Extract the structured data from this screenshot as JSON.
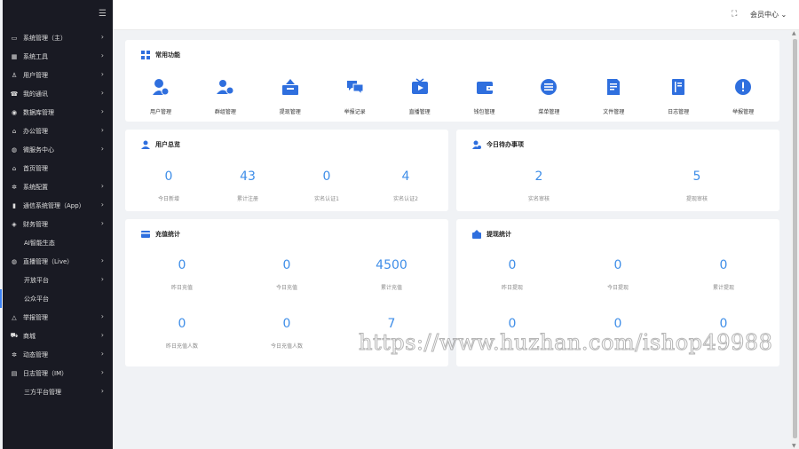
{
  "sidebar": {
    "items": [
      {
        "label": "系统管理（主）",
        "icon": "monitor-icon",
        "arrow": true
      },
      {
        "label": "系统工具",
        "icon": "grid-icon",
        "arrow": true
      },
      {
        "label": "用户管理",
        "icon": "users-icon",
        "arrow": true
      },
      {
        "label": "我的通讯",
        "icon": "phone-icon",
        "arrow": true
      },
      {
        "label": "数据库管理",
        "icon": "database-icon",
        "arrow": true
      },
      {
        "label": "办公管理",
        "icon": "office-icon",
        "arrow": true
      },
      {
        "label": "微服务中心",
        "icon": "globe-icon",
        "arrow": true
      },
      {
        "label": "首页管理",
        "icon": "home-icon",
        "arrow": false
      },
      {
        "label": "系统配置",
        "icon": "settings-icon",
        "arrow": true
      },
      {
        "label": "通信系统管理（App）",
        "icon": "signal-icon",
        "arrow": true
      },
      {
        "label": "财务管理",
        "icon": "finance-icon",
        "arrow": true
      },
      {
        "label": "AI智能生态",
        "icon": "",
        "arrow": false,
        "sub": true
      },
      {
        "label": "直播管理（Live）",
        "icon": "globe-icon",
        "arrow": true
      },
      {
        "label": "开放平台",
        "icon": "",
        "arrow": true,
        "sub": true
      },
      {
        "label": "公众平台",
        "icon": "",
        "arrow": false,
        "sub": true
      },
      {
        "label": "举报管理",
        "icon": "warning-icon",
        "arrow": true
      },
      {
        "label": "商城",
        "icon": "cart-icon",
        "arrow": true
      },
      {
        "label": "动态管理",
        "icon": "settings-icon",
        "arrow": true
      },
      {
        "label": "日志管理（IM）",
        "icon": "log-icon",
        "arrow": true
      },
      {
        "label": "三方平台管理",
        "icon": "",
        "arrow": true,
        "sub": true
      }
    ]
  },
  "header": {
    "member_center": "会员中心 ⌄"
  },
  "quick": {
    "title": "常用功能",
    "items": [
      {
        "label": "用户管理",
        "icon": "user-settings-icon"
      },
      {
        "label": "群组管理",
        "icon": "group-icon"
      },
      {
        "label": "提现管理",
        "icon": "withdraw-icon"
      },
      {
        "label": "举报记录",
        "icon": "chat-icon"
      },
      {
        "label": "直播管理",
        "icon": "video-icon"
      },
      {
        "label": "钱包管理",
        "icon": "wallet-icon"
      },
      {
        "label": "菜单管理",
        "icon": "menu-icon"
      },
      {
        "label": "文件管理",
        "icon": "file-icon"
      },
      {
        "label": "日志管理",
        "icon": "notebook-icon"
      },
      {
        "label": "举报管理",
        "icon": "alert-icon"
      }
    ]
  },
  "users": {
    "title": "用户总览",
    "stats": [
      {
        "value": "0",
        "label": "今日新增"
      },
      {
        "value": "43",
        "label": "累计注册"
      },
      {
        "value": "0",
        "label": "实名认证1"
      },
      {
        "value": "4",
        "label": "实名认证2"
      }
    ]
  },
  "todo": {
    "title": "今日待办事项",
    "stats": [
      {
        "value": "2",
        "label": "实名审核"
      },
      {
        "value": "5",
        "label": "提现审核"
      }
    ]
  },
  "recharge": {
    "title": "充值统计",
    "stats": [
      {
        "value": "0",
        "label": "昨日充值"
      },
      {
        "value": "0",
        "label": "今日充值"
      },
      {
        "value": "4500",
        "label": "累计充值"
      },
      {
        "value": "0",
        "label": "昨日充值人数"
      },
      {
        "value": "0",
        "label": "今日充值人数"
      },
      {
        "value": "7",
        "label": ""
      }
    ]
  },
  "withdraw": {
    "title": "提现统计",
    "stats": [
      {
        "value": "0",
        "label": "昨日提现"
      },
      {
        "value": "0",
        "label": "今日提现"
      },
      {
        "value": "0",
        "label": "累计提现"
      },
      {
        "value": "0",
        "label": ""
      },
      {
        "value": "0",
        "label": ""
      },
      {
        "value": "0",
        "label": ""
      }
    ]
  },
  "watermark": "https://www.huzhan.com/ishop49988",
  "colors": {
    "accent": "#2f6fde",
    "number": "#3f8ee8",
    "sidebar_bg": "#191a23"
  }
}
